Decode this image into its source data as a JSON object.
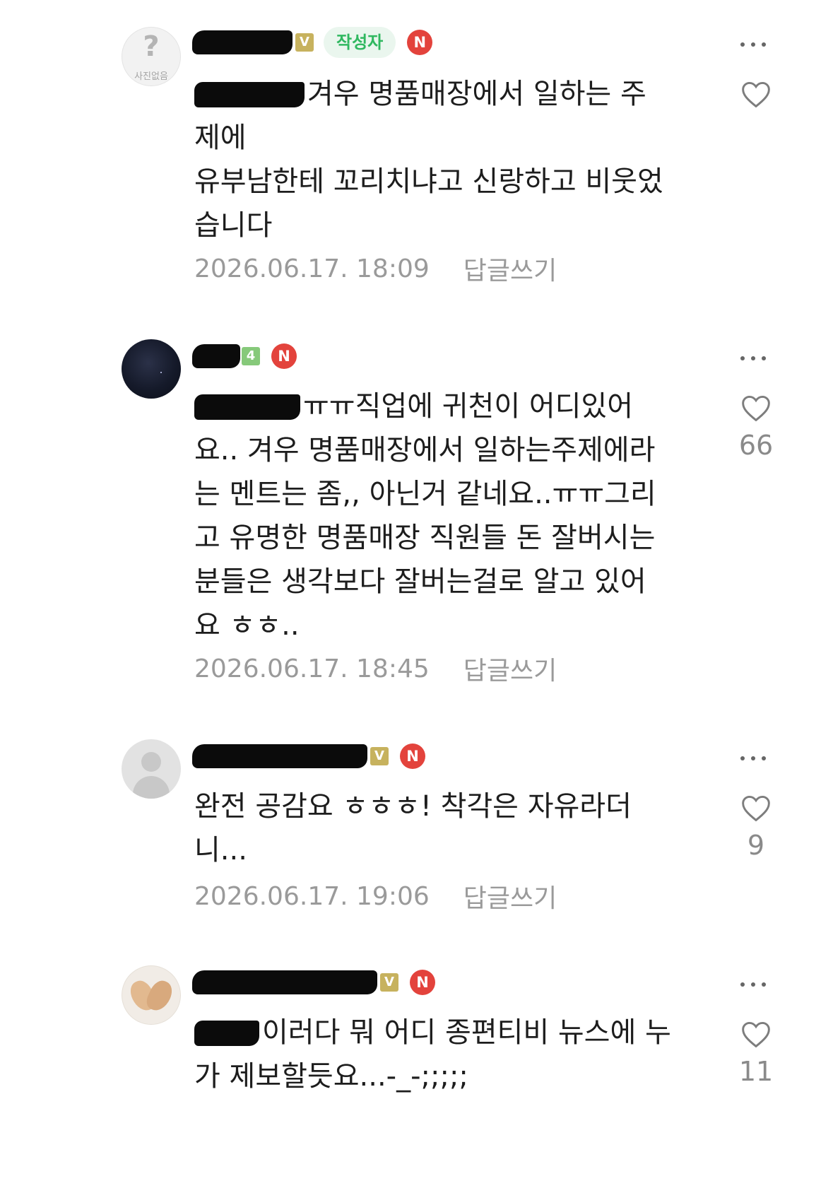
{
  "colors": {
    "author_badge_bg": "#eaf6ee",
    "author_badge_text": "#30b860",
    "n_badge": "#e3433c",
    "v_badge": "#c7b25e",
    "level_badge": "#86c97a",
    "meta_text": "#9a9a9a"
  },
  "comments": [
    {
      "avatar": {
        "type": "no-photo",
        "glyph": "?",
        "label": "사진없음"
      },
      "badges": {
        "grade": "V",
        "author": "작성자",
        "new": "N"
      },
      "lines": [
        "겨우 명품매장에서 일하는 주",
        "제에",
        "유부남한테 꼬리치냐고 신랑하고 비웃었",
        "습니다"
      ],
      "date": "2026.06.17. 18:09",
      "reply_label": "답글쓰기",
      "like_count": ""
    },
    {
      "avatar": {
        "type": "dark-photo"
      },
      "badges": {
        "grade": "4",
        "new": "N"
      },
      "lines": [
        "ㅠㅠ직업에 귀천이 어디있어",
        "요.. 겨우 명품매장에서 일하는주제에라",
        "는 멘트는 좀,, 아닌거 같네요..ㅠㅠ그리",
        "고 유명한 명품매장 직원들 돈 잘버시는",
        "분들은 생각보다 잘버는걸로 알고 있어",
        "요 ㅎㅎ.."
      ],
      "date": "2026.06.17. 18:45",
      "reply_label": "답글쓰기",
      "like_count": "66"
    },
    {
      "avatar": {
        "type": "default-silhouette"
      },
      "badges": {
        "grade": "V",
        "new": "N"
      },
      "lines": [
        "완전 공감요 ㅎㅎㅎ! 착각은 자유라더",
        "니..."
      ],
      "date": "2026.06.17. 19:06",
      "reply_label": "답글쓰기",
      "like_count": "9"
    },
    {
      "avatar": {
        "type": "heart-hands-photo"
      },
      "badges": {
        "grade": "V",
        "new": "N"
      },
      "lines": [
        "이러다 뭐 어디 종편티비 뉴스에 누",
        "가 제보할듯요...-_-;;;;;"
      ],
      "date": "",
      "reply_label": "",
      "like_count": "11"
    }
  ],
  "icons": {
    "more": "more-dots-icon",
    "like": "heart-outline-icon"
  }
}
